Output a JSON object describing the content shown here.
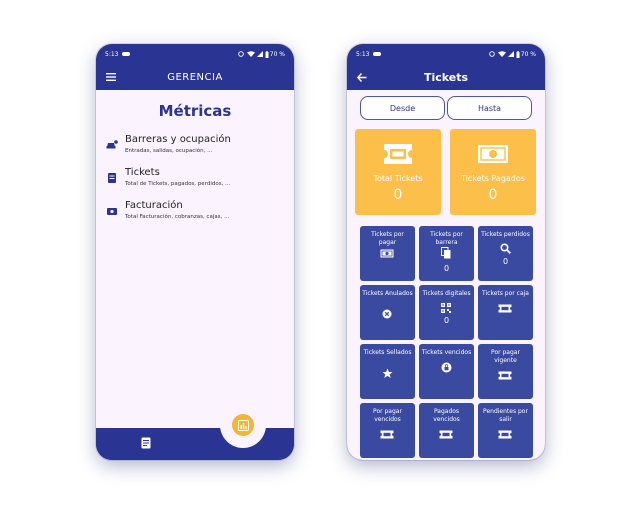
{
  "status_bar": {
    "time": "5:13",
    "battery": "70 %"
  },
  "left_screen": {
    "app_title": "GERENCIA",
    "heading": "Métricas",
    "items": [
      {
        "title": "Barreras y ocupación",
        "subtitle": "Entradas, salidas, ocupación, ...",
        "icon": "car-icon"
      },
      {
        "title": "Tickets",
        "subtitle": "Total de Tickets, pagados, perdidos, ...",
        "icon": "receipt-icon"
      },
      {
        "title": "Facturación",
        "subtitle": "Total Facturación, cobranzas, cajas, ...",
        "icon": "money-icon"
      }
    ]
  },
  "right_screen": {
    "app_title": "Tickets",
    "desde_label": "Desde",
    "hasta_label": "Hasta",
    "total_tickets": {
      "label": "Total Tickets",
      "value": "0"
    },
    "tickets_pagados": {
      "label": "Tickets Pagados",
      "value": "0"
    },
    "tiles": [
      {
        "label": "Tickets por pagar",
        "icon": "cash-icon",
        "value": ""
      },
      {
        "label": "Tickets por barrera",
        "icon": "file-copy-icon",
        "value": "0"
      },
      {
        "label": "Tickets perdidos",
        "icon": "search-icon",
        "value": "0"
      },
      {
        "label": "Tickets Anulados",
        "icon": "cancel-circle-icon",
        "value": ""
      },
      {
        "label": "Tickets digitales",
        "icon": "qr-code-icon",
        "value": "0"
      },
      {
        "label": "Tickets por caja",
        "icon": "ticket-icon",
        "value": ""
      },
      {
        "label": "Tickets Sellados",
        "icon": "star-icon",
        "value": ""
      },
      {
        "label": "Tickets vencidos",
        "icon": "lock-icon",
        "value": ""
      },
      {
        "label": "Por pagar vigente",
        "icon": "ticket-icon",
        "value": ""
      },
      {
        "label": "Por pagar vencidos",
        "icon": "ticket-icon",
        "value": ""
      },
      {
        "label": "Pagados vencidos",
        "icon": "ticket-icon",
        "value": ""
      },
      {
        "label": "Pendientes por salir",
        "icon": "ticket-icon",
        "value": ""
      }
    ]
  },
  "colors": {
    "primary": "#2a3593",
    "tile": "#3a4aa0",
    "accent": "#fcc04a",
    "background": "#fbf4ff"
  }
}
